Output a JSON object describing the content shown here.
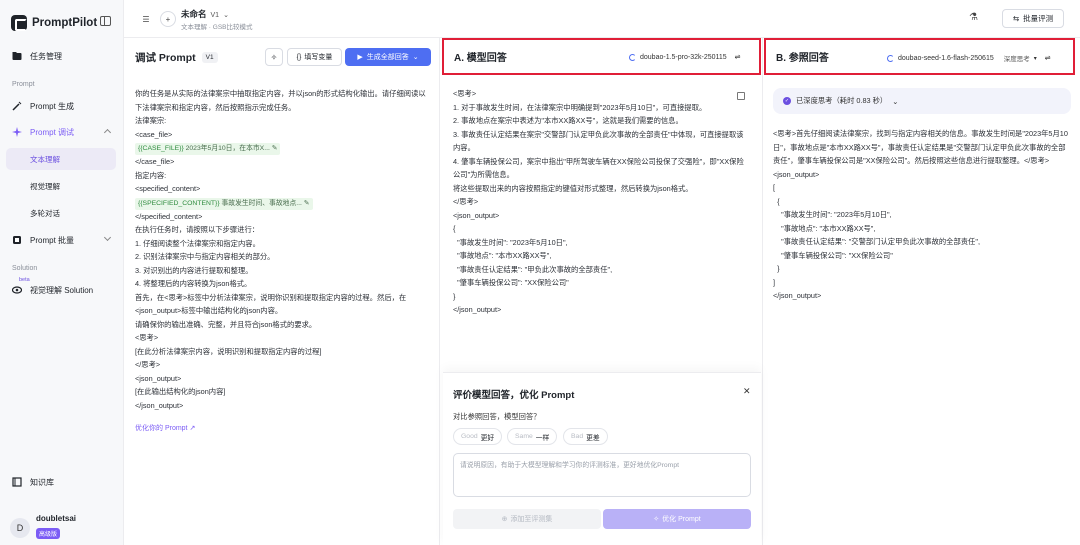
{
  "app": {
    "name": "PromptPilot"
  },
  "sidebar": {
    "items": [
      {
        "label": "任务管理"
      },
      {
        "section": "Prompt"
      },
      {
        "label": "Prompt 生成"
      },
      {
        "label": "Prompt 调试"
      },
      {
        "sub": "文本理解"
      },
      {
        "sub": "视觉理解"
      },
      {
        "sub": "多轮对话"
      },
      {
        "label": "Prompt 批量"
      },
      {
        "section": "Solution"
      },
      {
        "label": "视觉理解 Solution",
        "tag": "beta"
      },
      {
        "label": "知识库"
      }
    ],
    "user": {
      "initial": "D",
      "name": "doubletsai",
      "badge": "高级版"
    }
  },
  "topbar": {
    "title": "未命名",
    "version": "V1",
    "subtitle": "文本理解 · GSB比较模式",
    "batch": "批量评测"
  },
  "left": {
    "title": "调试 Prompt",
    "version": "V1",
    "fill_var": "填写变量",
    "generate": "生成全部回答",
    "lines": [
      "你的任务是从实际的法律案宗中抽取指定内容，并以json的形式结构化输出。请仔细阅读以下法律案宗和指定内容，然后按照指示完成任务。",
      "法律案宗:",
      "<case_file>",
      "__VAR1__",
      "</case_file>",
      "指定内容:",
      "<specified_content>",
      "__VAR2__",
      "</specified_content>",
      "在执行任务时，请按照以下步骤进行：",
      "1. 仔细阅读整个法律案宗和指定内容。",
      "2. 识别法律案宗中与指定内容相关的部分。",
      "3. 对识别出的内容进行提取和整理。",
      "4. 将整理后的内容转换为json格式。",
      "首先，在<思考>标签中分析法律案宗，说明你识别和提取指定内容的过程。然后，在<json_output>标签中输出结构化的json内容。",
      "请确保你的输出准确、完整，并且符合json格式的要求。",
      "<思考>",
      "[在此分析法律案宗内容，说明识别和提取指定内容的过程]",
      "</思考>",
      "<json_output>",
      "[在此输出结构化的json内容]",
      "</json_output>"
    ],
    "var1": {
      "name": "{{CASE_FILE}}",
      "value": "2023年5月10日，在本市X..."
    },
    "var2": {
      "name": "{{SPECIFIED_CONTENT}}",
      "value": "事故发生时间、事故地点..."
    },
    "optimize_link": "优化你的 Prompt"
  },
  "a": {
    "title": "A. 模型回答",
    "model": "doubao-1.5-pro-32k-250115",
    "lines": [
      "<思考>",
      "1. 对于事故发生时间，在法律案宗中明确提到\"2023年5月10日\"，可直接提取。",
      "2. 事故地点在案宗中表述为\"本市XX路XX号\"，这就是我们需要的信息。",
      "3. 事故责任认定结果在案宗\"交警部门认定甲负此次事故的全部责任\"中体现，可直接提取该内容。",
      "4. 肇事车辆投保公司，案宗中指出\"甲所驾驶车辆在XX保险公司投保了交强险\"，即\"XX保险公司\"为所需信息。",
      "将这些提取出来的内容按照指定的键值对形式整理，然后转换为json格式。",
      "</思考>",
      "<json_output>",
      "{",
      "  \"事故发生时间\": \"2023年5月10日\",",
      "  \"事故地点\": \"本市XX路XX号\",",
      "  \"事故责任认定结果\": \"甲负此次事故的全部责任\",",
      "  \"肇事车辆投保公司\": \"XX保险公司\"",
      "}",
      "</json_output>"
    ]
  },
  "b": {
    "title": "B. 参照回答",
    "model": "doubao-seed-1.6-flash-250615",
    "mode": "深度思考",
    "deep": "已深度思考（耗时 0.83 秒）",
    "lines": [
      "<思考>首先仔细阅读法律案宗，找到与指定内容相关的信息。事故发生时间是\"2023年5月10日\"，事故地点是\"本市XX路XX号\"，事故责任认定结果是\"交警部门认定甲负此次事故的全部责任\"，肇事车辆投保公司是\"XX保险公司\"。然后按照这些信息进行提取整理。</思考>",
      "<json_output>",
      "[",
      "  {",
      "    \"事故发生时间\": \"2023年5月10日\",",
      "    \"事故地点\": \"本市XX路XX号\",",
      "    \"事故责任认定结果\": \"交警部门认定甲负此次事故的全部责任\",",
      "    \"肇事车辆投保公司\": \"XX保险公司\"",
      "  }",
      "]",
      "</json_output>"
    ]
  },
  "eval": {
    "title": "评价模型回答，优化 Prompt",
    "question": "对比参照回答，模型回答？",
    "chips": [
      {
        "en": "Good",
        "zh": "更好"
      },
      {
        "en": "Same",
        "zh": "一样"
      },
      {
        "en": "Bad",
        "zh": "更差"
      }
    ],
    "placeholder": "请说明原因，有助于大模型理解和学习你的评测标准，更好地优化Prompt",
    "add": "添加至评测集",
    "optimize": "优化 Prompt"
  }
}
